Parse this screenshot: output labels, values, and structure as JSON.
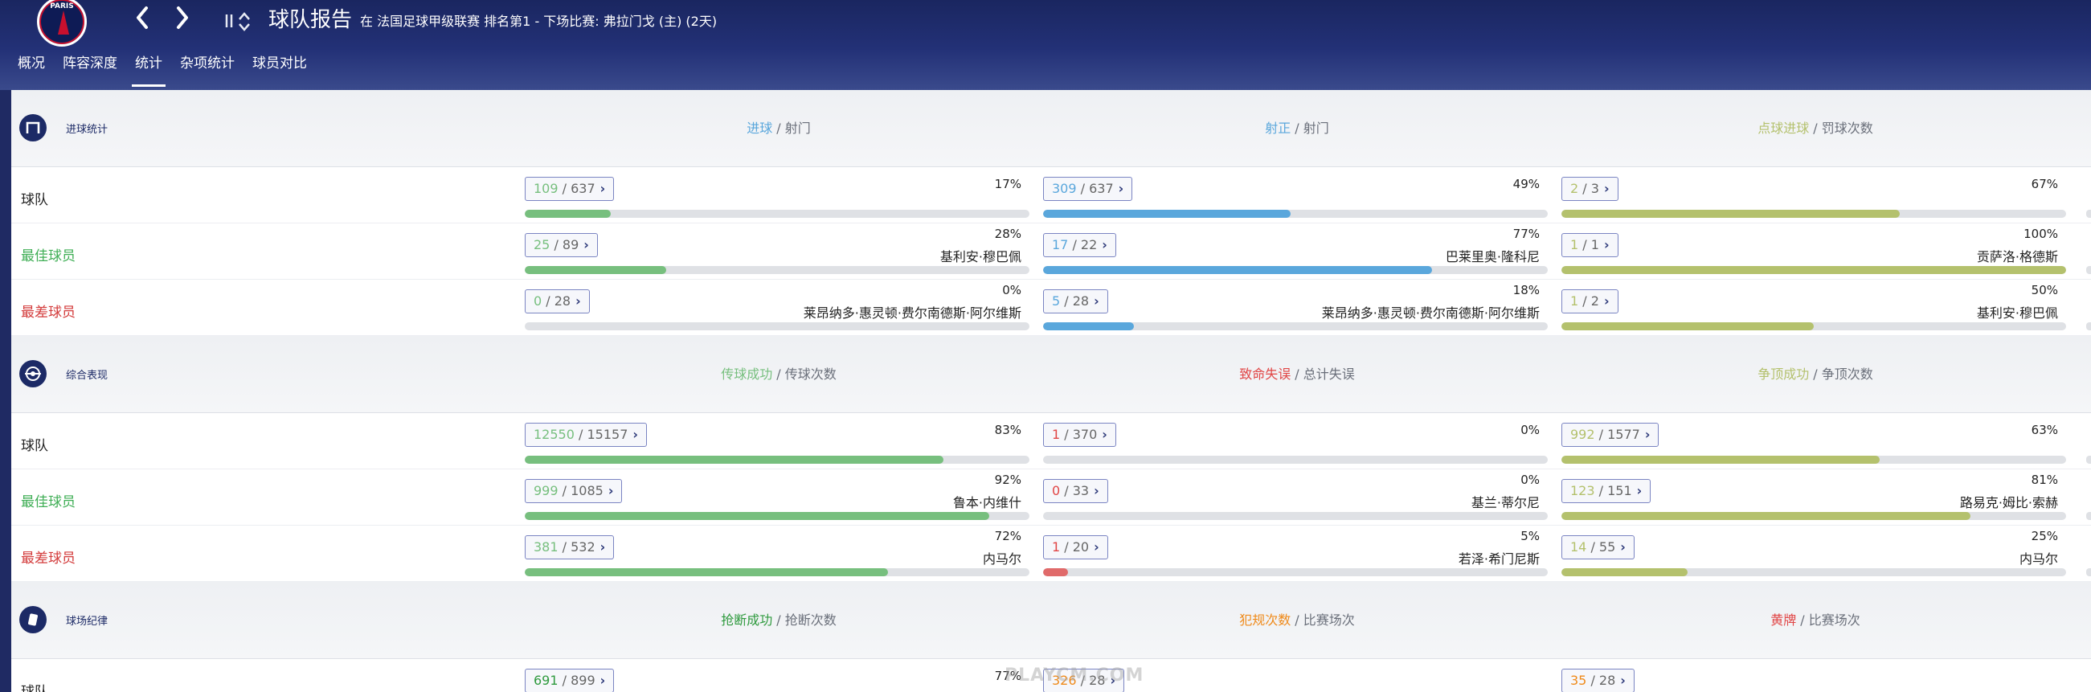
{
  "header": {
    "title": "球队报告",
    "subtitle": "在 法国足球甲级联赛 排名第1 - 下场比赛: 弗拉门戈 (主) (2天)",
    "logo_text": "PARIS",
    "back_icon": "chevron-left-icon",
    "forward_icon": "chevron-right-icon",
    "sort_icon": "sort-arrows-icon"
  },
  "tabs": [
    {
      "label": "概况",
      "active": false
    },
    {
      "label": "阵容深度",
      "active": false
    },
    {
      "label": "统计",
      "active": true
    },
    {
      "label": "杂项统计",
      "active": false
    },
    {
      "label": "球员对比",
      "active": false
    }
  ],
  "row_labels": {
    "team": "球队",
    "best": "最佳球员",
    "worst": "最差球员"
  },
  "colors": {
    "green": "#77bf7e",
    "blue": "#5aa7dc",
    "olive": "#b4c16d",
    "red": "#e06a6a",
    "best_label": "#3fae55",
    "worst_label": "#d33b3b",
    "dark_green": "#2f9a3e",
    "orange": "#ef8a1a",
    "text_red": "#e14545"
  },
  "sections": [
    {
      "title": "进球统计",
      "icon": "goal-frame-icon",
      "columns": [
        {
          "head_hl": "进球",
          "head_rest": " / 射门",
          "hl_color": "#5aa7dc",
          "bar_color": "#77bf7e",
          "num_color": "#77bf7e",
          "rows": [
            {
              "num": "109",
              "den": "637",
              "pct": "17%",
              "player": "",
              "fill": 0.17
            },
            {
              "num": "25",
              "den": "89",
              "pct": "28%",
              "player": "基利安·穆巴佩",
              "fill": 0.28
            },
            {
              "num": "0",
              "den": "28",
              "pct": "0%",
              "player": "莱昂纳多·惠灵顿·费尔南德斯·阿尔维斯",
              "fill": 0.0
            }
          ]
        },
        {
          "head_hl": "射正",
          "head_rest": " / 射门",
          "hl_color": "#5aa7dc",
          "bar_color": "#5aa7dc",
          "num_color": "#5aa7dc",
          "rows": [
            {
              "num": "309",
              "den": "637",
              "pct": "49%",
              "player": "",
              "fill": 0.49
            },
            {
              "num": "17",
              "den": "22",
              "pct": "77%",
              "player": "巴莱里奥·隆科尼",
              "fill": 0.77
            },
            {
              "num": "5",
              "den": "28",
              "pct": "18%",
              "player": "莱昂纳多·惠灵顿·费尔南德斯·阿尔维斯",
              "fill": 0.18
            }
          ]
        },
        {
          "head_hl": "点球进球",
          "head_rest": " / 罚球次数",
          "hl_color": "#b4c16d",
          "bar_color": "#b4c16d",
          "num_color": "#b4c16d",
          "rows": [
            {
              "num": "2",
              "den": "3",
              "pct": "67%",
              "player": "",
              "fill": 0.67
            },
            {
              "num": "1",
              "den": "1",
              "pct": "100%",
              "player": "贡萨洛·格德斯",
              "fill": 1.0
            },
            {
              "num": "1",
              "den": "2",
              "pct": "50%",
              "player": "基利安·穆巴佩",
              "fill": 0.5
            }
          ]
        }
      ]
    },
    {
      "title": "综合表现",
      "icon": "performance-target-icon",
      "columns": [
        {
          "head_hl": "传球成功",
          "head_rest": " / 传球次数",
          "hl_color": "#77bf7e",
          "bar_color": "#77bf7e",
          "num_color": "#77bf7e",
          "rows": [
            {
              "num": "12550",
              "den": "15157",
              "pct": "83%",
              "player": "",
              "fill": 0.83
            },
            {
              "num": "999",
              "den": "1085",
              "pct": "92%",
              "player": "鲁本·内维什",
              "fill": 0.92
            },
            {
              "num": "381",
              "den": "532",
              "pct": "72%",
              "player": "内马尔",
              "fill": 0.72
            }
          ]
        },
        {
          "head_hl": "致命失误",
          "head_rest": " / 总计失误",
          "hl_color": "#e14545",
          "bar_color": "#e06a6a",
          "num_color": "#e14545",
          "rows": [
            {
              "num": "1",
              "den": "370",
              "pct": "0%",
              "player": "",
              "fill": 0.0
            },
            {
              "num": "0",
              "den": "33",
              "pct": "0%",
              "player": "基兰·蒂尔尼",
              "fill": 0.0
            },
            {
              "num": "1",
              "den": "20",
              "pct": "5%",
              "player": "若泽·希门尼斯",
              "fill": 0.05
            }
          ]
        },
        {
          "head_hl": "争顶成功",
          "head_rest": " / 争顶次数",
          "hl_color": "#b4c16d",
          "bar_color": "#b4c16d",
          "num_color": "#b4c16d",
          "rows": [
            {
              "num": "992",
              "den": "1577",
              "pct": "63%",
              "player": "",
              "fill": 0.63
            },
            {
              "num": "123",
              "den": "151",
              "pct": "81%",
              "player": "路易克·姆比·索赫",
              "fill": 0.81
            },
            {
              "num": "14",
              "den": "55",
              "pct": "25%",
              "player": "内马尔",
              "fill": 0.25
            }
          ]
        }
      ]
    },
    {
      "title": "球场纪律",
      "icon": "card-icon",
      "columns": [
        {
          "head_hl": "抢断成功",
          "head_rest": " / 抢断次数",
          "hl_color": "#2f9a3e",
          "bar_color": "#2f9a3e",
          "num_color": "#2f9a3e",
          "rows": [
            {
              "num": "691",
              "den": "899",
              "pct": "77%",
              "player": "",
              "fill": 0.77
            }
          ]
        },
        {
          "head_hl": "犯规次数",
          "head_rest": " / 比赛场次",
          "hl_color": "#ef8a1a",
          "bar_color": "#ef8a1a",
          "num_color": "#ef8a1a",
          "rows": [
            {
              "num": "326",
              "den": "28",
              "pct": "",
              "player": "",
              "fill": 0.0
            }
          ]
        },
        {
          "head_hl": "黄牌",
          "head_rest": " / 比赛场次",
          "hl_color": "#e14545",
          "bar_color": "#ef8a1a",
          "num_color": "#ef8a1a",
          "rows": [
            {
              "num": "35",
              "den": "28",
              "pct": "",
              "player": "",
              "fill": 0.0
            }
          ]
        }
      ]
    }
  ],
  "watermark": "PLAYCM.COM"
}
